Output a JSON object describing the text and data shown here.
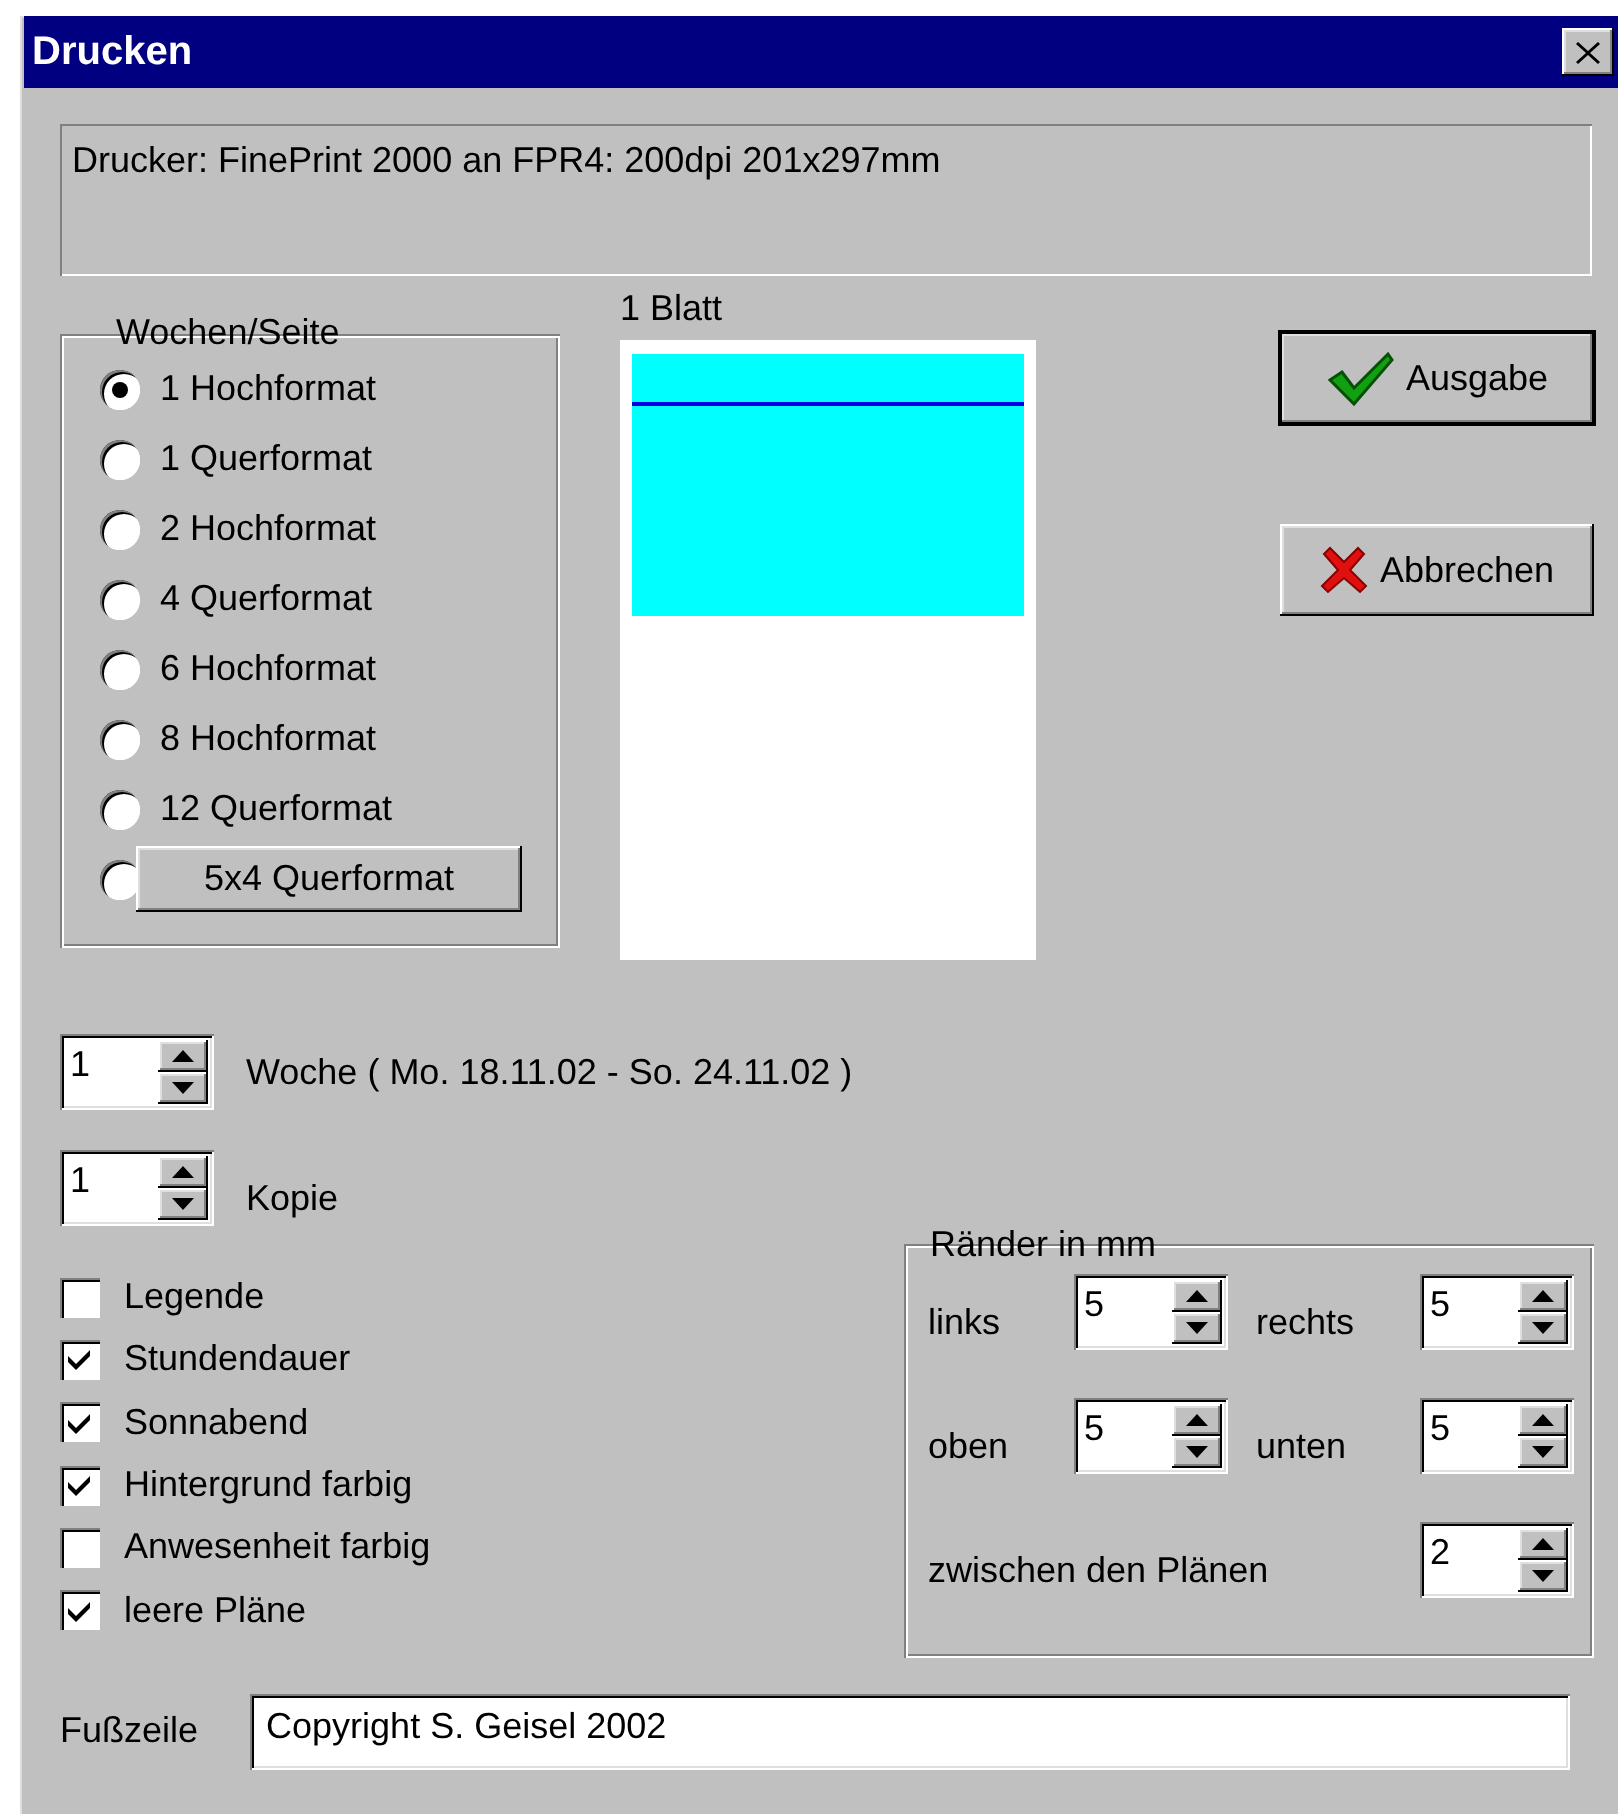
{
  "window": {
    "title": "Drucken"
  },
  "printer_info": "Drucker: FinePrint 2000 an FPR4: 200dpi 201x297mm",
  "weeks_per_page": {
    "label": "Wochen/Seite",
    "options": [
      {
        "label": "1 Hochformat",
        "selected": true,
        "kind": "radio"
      },
      {
        "label": "1 Querformat",
        "selected": false,
        "kind": "radio"
      },
      {
        "label": "2 Hochformat",
        "selected": false,
        "kind": "radio"
      },
      {
        "label": "4 Querformat",
        "selected": false,
        "kind": "radio"
      },
      {
        "label": "6 Hochformat",
        "selected": false,
        "kind": "radio"
      },
      {
        "label": "8 Hochformat",
        "selected": false,
        "kind": "radio"
      },
      {
        "label": "12 Querformat",
        "selected": false,
        "kind": "radio"
      },
      {
        "label": "5x4 Querformat",
        "selected": false,
        "kind": "button"
      }
    ]
  },
  "preview": {
    "label": "1 Blatt"
  },
  "buttons": [
    {
      "label": "Ausgabe",
      "kind": "ok",
      "default": true
    },
    {
      "label": "Abbrechen",
      "kind": "cancel",
      "default": false
    }
  ],
  "week": {
    "value": "1",
    "label": "Woche ( Mo. 18.11.02 - So. 24.11.02 )"
  },
  "copies": {
    "value": "1",
    "label": "Kopie"
  },
  "options": [
    {
      "label": "Legende",
      "checked": false
    },
    {
      "label": "Stundendauer",
      "checked": true
    },
    {
      "label": "Sonnabend",
      "checked": true
    },
    {
      "label": "Hintergrund farbig",
      "checked": true
    },
    {
      "label": "Anwesenheit farbig",
      "checked": false
    },
    {
      "label": "leere Pläne",
      "checked": true
    }
  ],
  "margins": {
    "title": "Ränder in mm",
    "fields": [
      {
        "label": "links",
        "value": "5"
      },
      {
        "label": "rechts",
        "value": "5"
      },
      {
        "label": "oben",
        "value": "5"
      },
      {
        "label": "unten",
        "value": "5"
      },
      {
        "label": "zwischen den Plänen",
        "value": "2"
      }
    ]
  },
  "footer": {
    "label": "Fußzeile",
    "value": "Copyright S. Geisel 2002"
  }
}
